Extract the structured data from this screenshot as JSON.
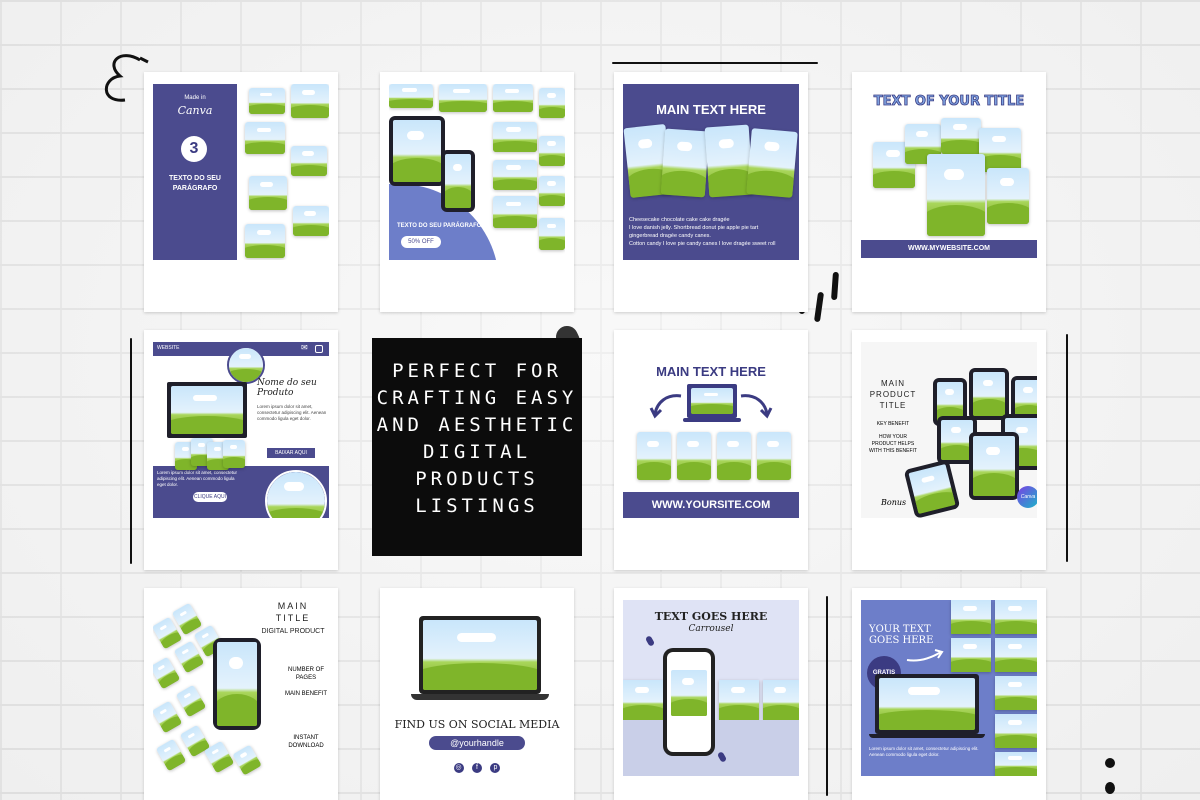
{
  "tiles": {
    "t1": {
      "made_in": "Made in",
      "canva": "Canva",
      "number": "3",
      "caption": "TEXTO DO SEU PARÁGRAFO"
    },
    "t2": {
      "caption": "TEXTO DO SEU PARÁGRAFO",
      "offer": "50% OFF"
    },
    "t3": {
      "title": "MAIN TEXT HERE",
      "bullets": [
        "Cheesecake chocolate cake cake dragée",
        "I love danish jelly. Shortbread donut pie apple pie tart",
        "gingerbread dragée candy canes.",
        "Cotton candy I love pie candy canes I love dragée sweet roll"
      ]
    },
    "t4": {
      "title": "TEXT OF YOUR TITLE",
      "website": "WWW.MYWEBSITE.COM"
    },
    "t5": {
      "nav": "WEBSITE",
      "script": "Nome do seu Produto",
      "body": "Lorem ipsum dolor sit amet, consectetur adipiscing elit. Aenean commodo ligula eget dolor.",
      "button": "BAIXAR AQUI",
      "cta": "CLIQUE AQUI"
    },
    "t6": {
      "title": "MAIN TEXT HERE",
      "website": "WWW.YOURSITE.COM"
    },
    "t7": {
      "line1": "MAIN",
      "line2": "PRODUCT",
      "line3": "TITLE",
      "benefit": "KEY BENEFIT",
      "help": "HOW YOUR PRODUCT HELPS WITH THIS BENEFIT",
      "bonus": "Bonus",
      "badge": "Canva"
    },
    "t8": {
      "title1": "MAIN",
      "title2": "TITLE",
      "sub": "DIGITAL PRODUCT",
      "pages": "NUMBER OF PAGES",
      "benefit": "MAIN BENEFIT",
      "download": "INSTANT DOWNLOAD"
    },
    "t9": {
      "find": "FIND US ON SOCIAL MEDIA",
      "handle": "@yourhandle"
    },
    "t10": {
      "title": "TEXT GOES HERE",
      "script": "Carrousel"
    },
    "t11": {
      "title1": "YOUR TEXT",
      "title2": "GOES HERE",
      "badge": "GRATIS"
    }
  },
  "center_message": "PERFECT FOR CRAFTING EASY AND AESTHETIC DIGITAL PRODUCTS LISTINGS"
}
